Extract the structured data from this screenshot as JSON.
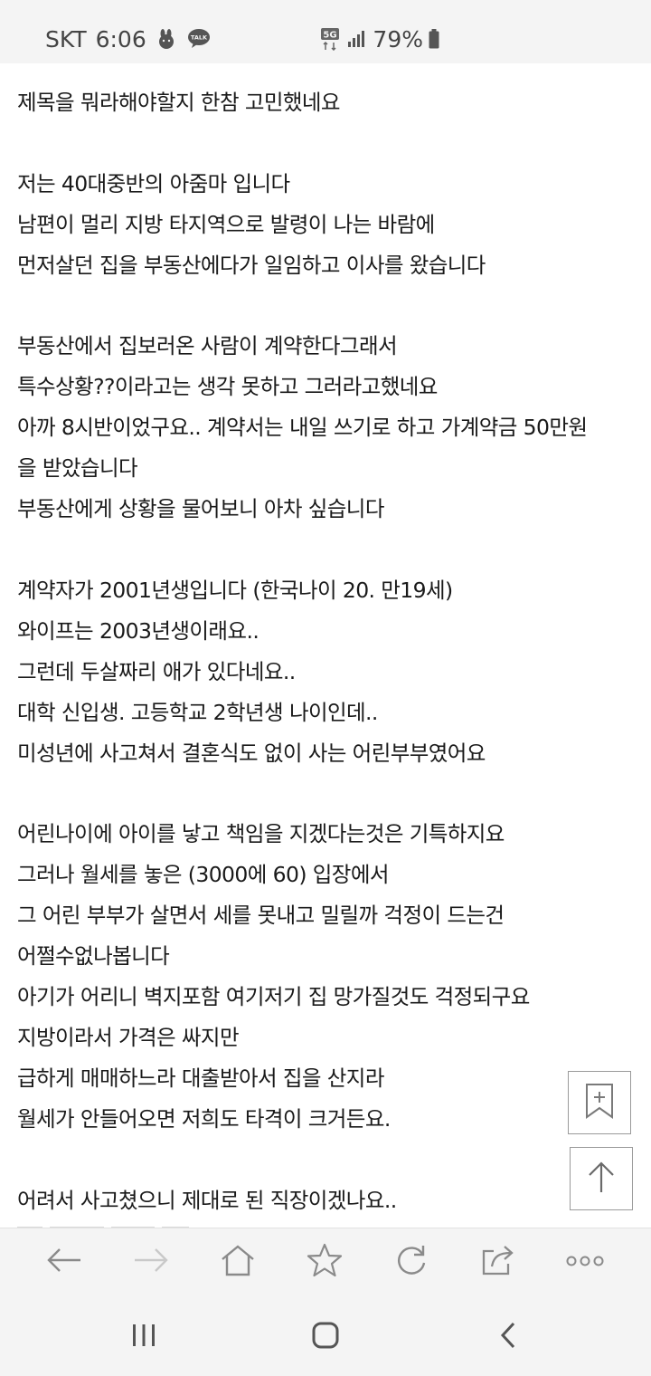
{
  "status_bar": {
    "carrier": "SKT",
    "time": "6:06",
    "talk_badge": "TALK",
    "network": "5G",
    "battery": "79%"
  },
  "article": {
    "lines": [
      "제목을 뭐라해야할지 한참 고민했네요",
      "",
      "저는 40대중반의 아줌마 입니다",
      "남편이 멀리 지방 타지역으로 발령이 나는 바람에",
      "먼저살던 집을 부동산에다가 일임하고 이사를 왔습니다",
      "",
      "부동산에서 집보러온 사람이 계약한다그래서",
      "특수상황??이라고는 생각 못하고 그러라고했네요",
      "아까 8시반이었구요.. 계약서는 내일 쓰기로 하고 가계약금 50만원",
      "을 받았습니다",
      "부동산에게 상황을 물어보니 아차 싶습니다",
      "",
      "계약자가 2001년생입니다 (한국나이 20. 만19세)",
      "와이프는 2003년생이래요..",
      "그런데 두살짜리 애가 있다네요..",
      "대학 신입생. 고등학교 2학년생 나이인데..",
      "미성년에 사고쳐서 결혼식도 없이 사는 어린부부였어요",
      "",
      "어린나이에 아이를 낳고 책임을 지겠다는것은 기특하지요",
      "그러나 월세를 놓은 (3000에 60) 입장에서",
      "그 어린 부부가 살면서 세를 못내고 밀릴까 걱정이 드는건",
      "어쩔수없나봅니다",
      "아기가 어리니 벽지포함 여기저기 집 망가질것도 걱정되구요",
      "지방이라서 가격은 싸지만",
      "급하게 매매하느라 대출받아서 집을 산지라",
      "월세가 안들어오면 저희도 타격이 크거든요.",
      "",
      "어려서 사고쳤으니 제대로 된 직장이겠나요.."
    ]
  },
  "icons": {
    "add_bookmark": "bookmark-plus-icon",
    "scroll_top": "arrow-up-icon",
    "back": "arrow-left-icon",
    "forward": "arrow-right-icon",
    "home": "home-icon",
    "bookmarks": "star-icon",
    "reload": "reload-icon",
    "share": "share-icon",
    "more": "more-dots-icon",
    "recents": "recent-apps-icon",
    "nav_home": "nav-home-icon",
    "nav_back": "nav-back-icon"
  },
  "colors": {
    "text": "#1a1a1a",
    "bar_bg": "#f4f4f4",
    "icon": "#8a8a8a",
    "icon_disabled": "#c9c9c9"
  }
}
